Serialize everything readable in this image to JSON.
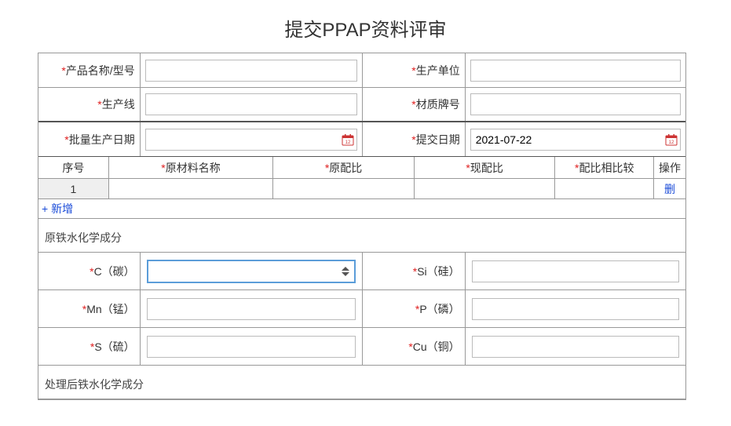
{
  "title": "提交PPAP资料评审",
  "header": {
    "product_name_label": "产品名称/型号",
    "product_name_value": "",
    "production_unit_label": "生产单位",
    "production_unit_value": "",
    "production_line_label": "生产线",
    "production_line_value": "",
    "material_grade_label": "材质牌号",
    "material_grade_value": "",
    "batch_date_label": "批量生产日期",
    "batch_date_value": "",
    "submit_date_label": "提交日期",
    "submit_date_value": "2021-07-22"
  },
  "materials_table": {
    "headers": {
      "seq": "序号",
      "name": "原材料名称",
      "orig_ratio": "原配比",
      "now_ratio": "现配比",
      "cmp_ratio": "配比相比较",
      "op": "操作"
    },
    "rows": [
      {
        "seq": "1",
        "name": "",
        "orig_ratio": "",
        "now_ratio": "",
        "cmp_ratio": "",
        "op_label": "删"
      }
    ],
    "add_label": "+ 新增"
  },
  "chem_before": {
    "section_title": "原铁水化学成分",
    "c_label": "C（碳）",
    "c_value": "",
    "si_label": "Si（硅）",
    "si_value": "",
    "mn_label": "Mn（锰）",
    "mn_value": "",
    "p_label": "P（磷）",
    "p_value": "",
    "s_label": "S（硫）",
    "s_value": "",
    "cu_label": "Cu（铜）",
    "cu_value": ""
  },
  "chem_after": {
    "section_title": "处理后铁水化学成分"
  }
}
